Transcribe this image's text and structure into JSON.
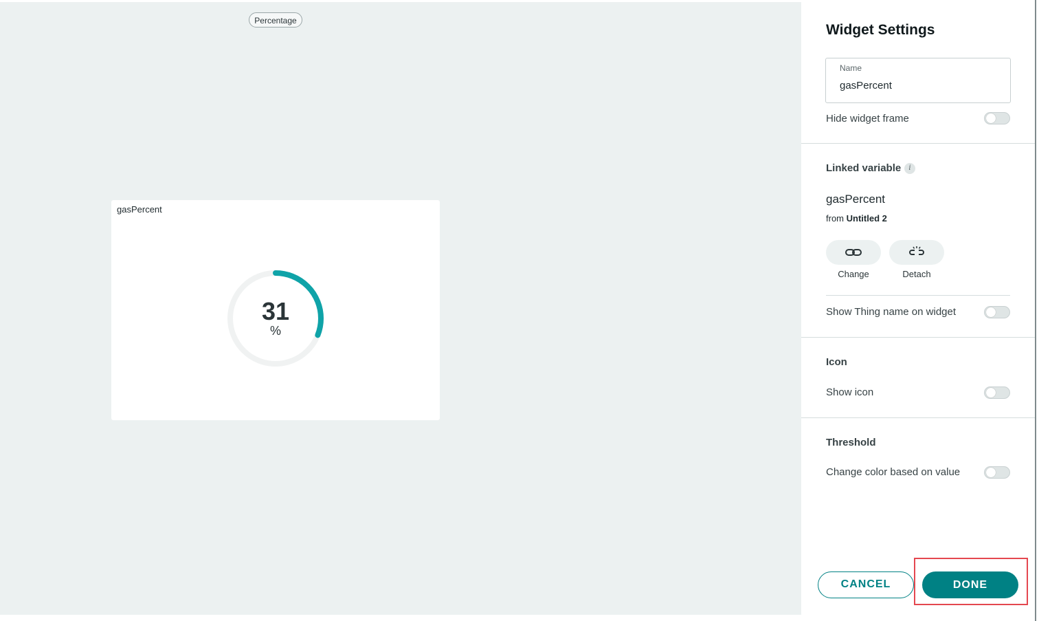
{
  "canvas": {
    "pill_label": "Percentage",
    "widget": {
      "title": "gasPercent",
      "value": "31",
      "unit": "%",
      "progress_fraction": 0.31,
      "accent_color": "#0fa3a8"
    }
  },
  "panel": {
    "title": "Widget Settings",
    "name_field": {
      "label": "Name",
      "value": "gasPercent"
    },
    "hide_frame": {
      "label": "Hide widget frame",
      "on": false
    },
    "linked_variable": {
      "title": "Linked variable",
      "info_icon": "i",
      "variable_name": "gasPercent",
      "from_prefix": "from",
      "from_thing": "Untitled 2",
      "change_label": "Change",
      "detach_label": "Detach",
      "show_thing_name": {
        "label": "Show Thing name on widget",
        "on": false
      }
    },
    "icon_section": {
      "title": "Icon",
      "show_icon": {
        "label": "Show icon",
        "on": false
      }
    },
    "threshold_section": {
      "title": "Threshold",
      "change_color": {
        "label": "Change color based on value",
        "on": false
      }
    },
    "buttons": {
      "cancel": "CANCEL",
      "done": "DONE"
    }
  },
  "colors": {
    "brand_teal": "#008184",
    "canvas_bg": "#ecf1f1",
    "highlight_red": "#e4474f"
  }
}
